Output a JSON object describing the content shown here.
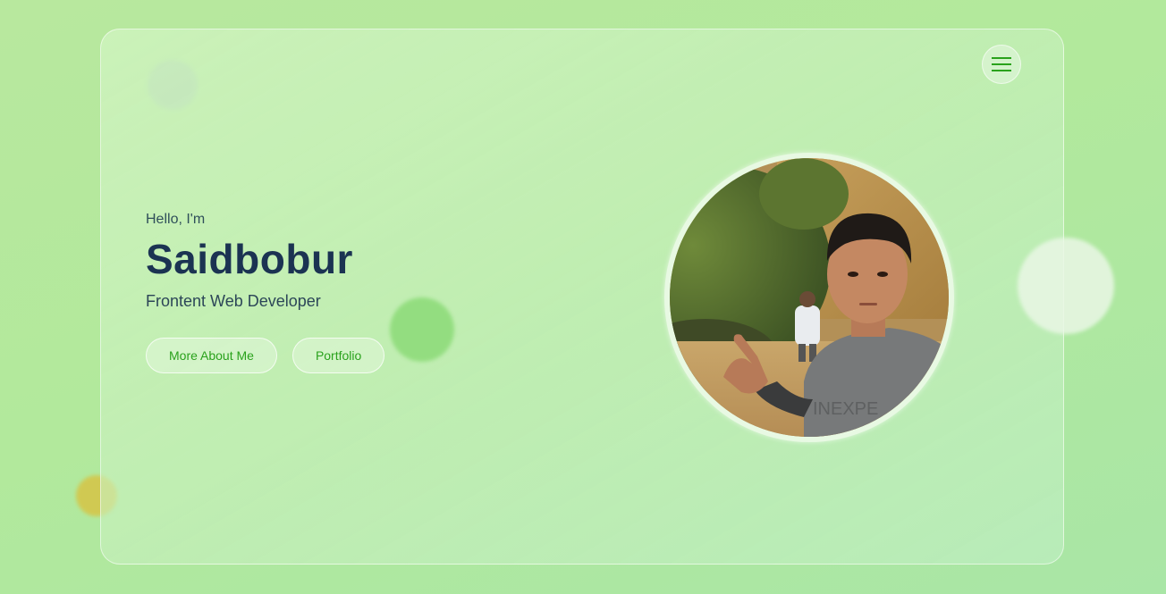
{
  "header": {
    "menu_icon": "hamburger-menu-icon"
  },
  "hero": {
    "greeting": "Hello, I'm",
    "name": "Saidbobur",
    "role": "Frontent Web Developer",
    "buttons": {
      "about_label": "More About Me",
      "portfolio_label": "Portfolio"
    }
  },
  "colors": {
    "accent": "#2aa21c",
    "heading": "#1b3352",
    "background": "#b6e89c"
  }
}
